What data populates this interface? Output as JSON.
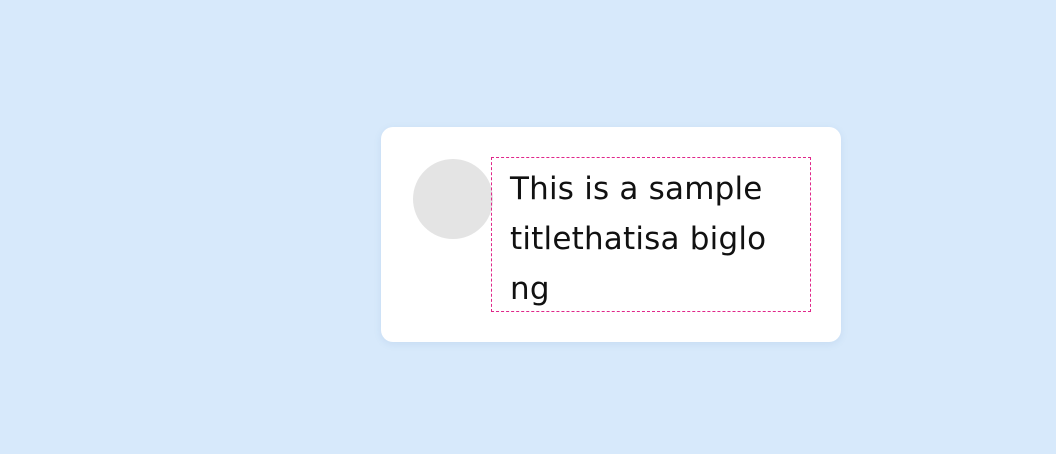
{
  "card": {
    "title": "This is a sampletitlethatisa biglong"
  },
  "colors": {
    "background": "#d7e9fb",
    "card": "#ffffff",
    "avatar": "#e4e4e4",
    "outline": "#e0278a",
    "text": "#111111"
  }
}
